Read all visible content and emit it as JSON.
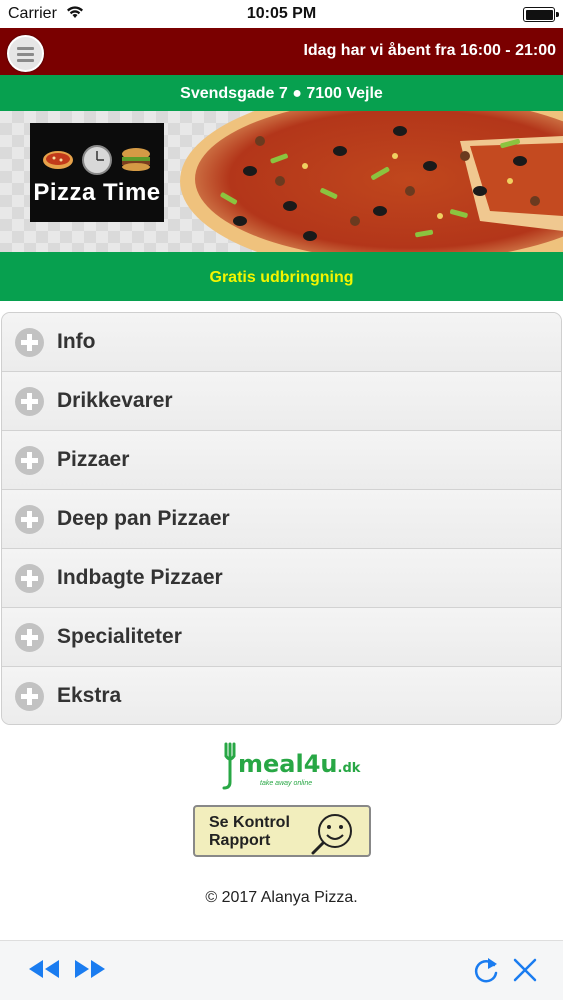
{
  "status_bar": {
    "carrier": "Carrier",
    "time": "10:05 PM"
  },
  "header": {
    "opening_hours": "Idag har vi åbent fra 16:00 - 21:00",
    "address": "Svendsgade 7 ● 7100 Vejle"
  },
  "banner": {
    "logo_text": "Pizza Time"
  },
  "delivery": {
    "text": "Gratis udbringning"
  },
  "menu": {
    "items": [
      {
        "label": "Info"
      },
      {
        "label": "Drikkevarer"
      },
      {
        "label": "Pizzaer"
      },
      {
        "label": "Deep pan Pizzaer"
      },
      {
        "label": "Indbagte Pizzaer"
      },
      {
        "label": "Specialiteter"
      },
      {
        "label": "Ekstra"
      }
    ]
  },
  "footer": {
    "meal4u_brand": "meal4u",
    "meal4u_domain": ".dk",
    "meal4u_tagline": "take away online",
    "kontrol_line1": "Se Kontrol",
    "kontrol_line2": "Rapport",
    "copyright": "© 2017 Alanya Pizza."
  },
  "icons": {
    "menu": "hamburger-menu-icon",
    "expand": "plus-circle-icon",
    "back": "rewind-icon",
    "forward": "fast-forward-icon",
    "reload": "reload-icon",
    "close": "close-icon"
  },
  "colors": {
    "top_bar": "#7a0000",
    "green_bar": "#07a04f",
    "delivery_text": "#f3f500",
    "toolbar_accent": "#1a7cf0"
  }
}
